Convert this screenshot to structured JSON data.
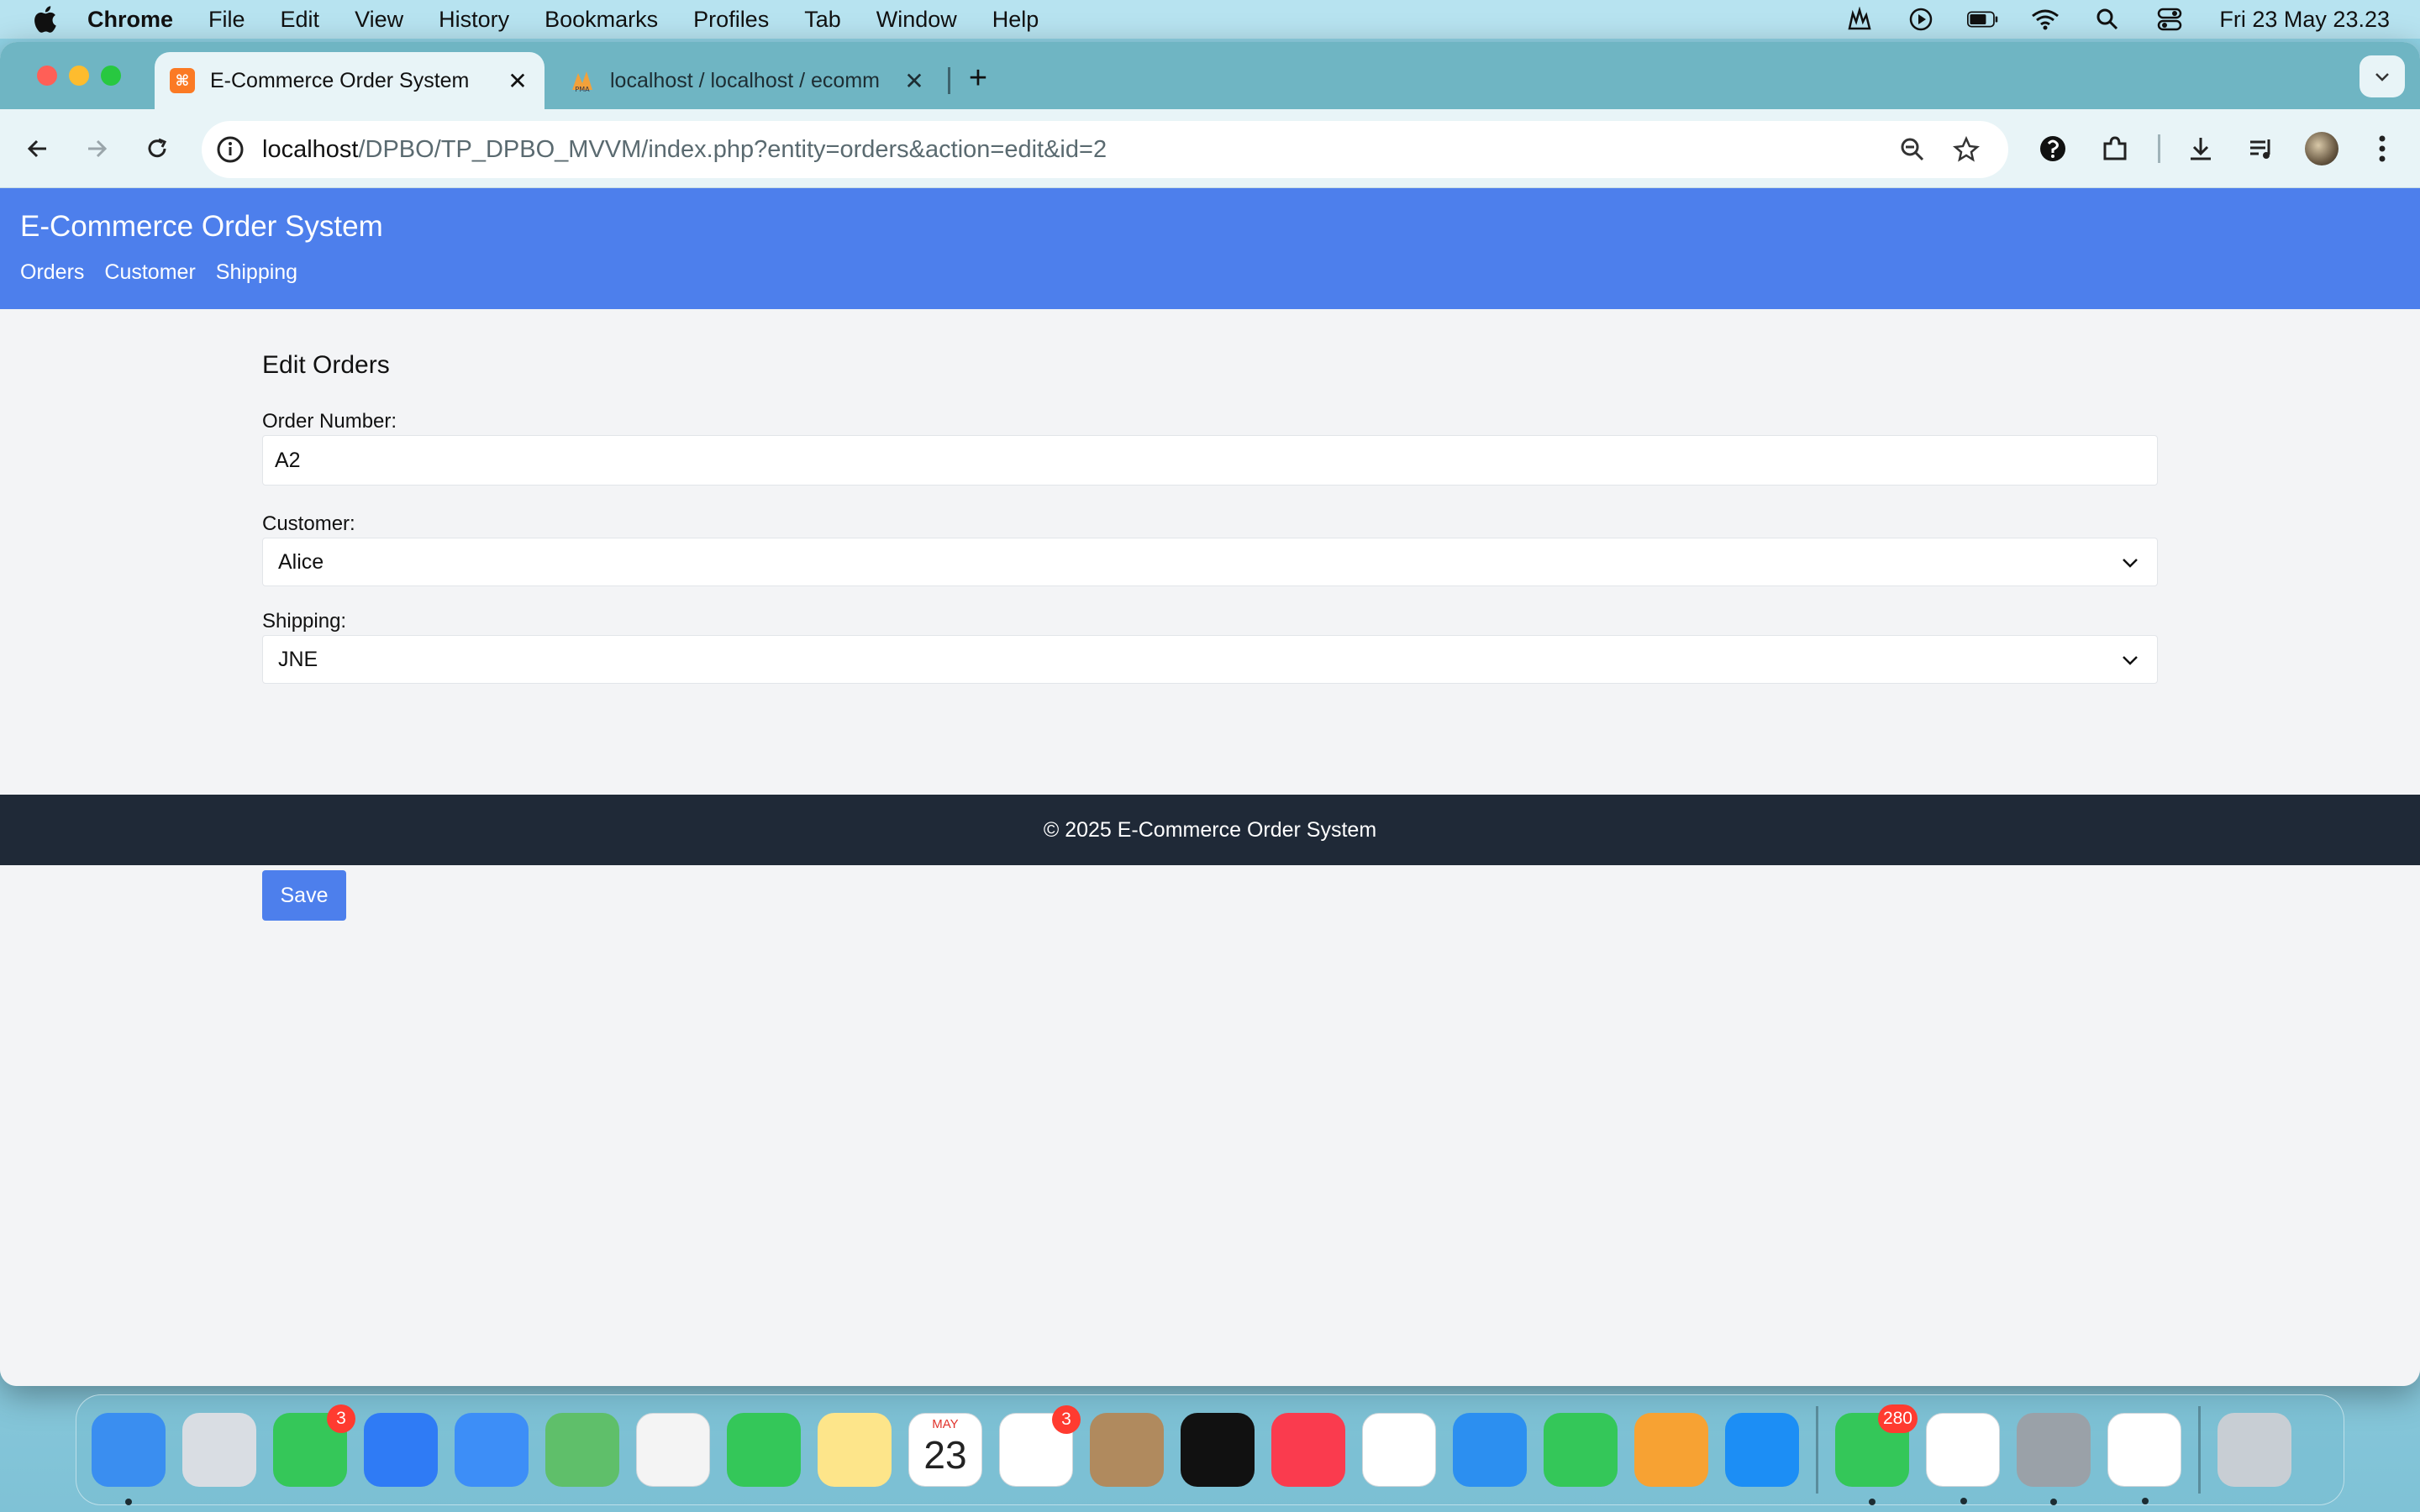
{
  "menubar": {
    "app_name": "Chrome",
    "items": [
      "File",
      "Edit",
      "View",
      "History",
      "Bookmarks",
      "Profiles",
      "Tab",
      "Window",
      "Help"
    ],
    "clock": "Fri 23 May  23.23"
  },
  "browser": {
    "tabs": [
      {
        "title": "E-Commerce Order System",
        "close": "✕"
      },
      {
        "title": "localhost / localhost / ecomm",
        "close": "✕"
      }
    ],
    "new_tab": "+",
    "address": {
      "host": "localhost",
      "path": "/DPBO/TP_DPBO_MVVM/index.php?entity=orders&action=edit&id=2"
    }
  },
  "site": {
    "title": "E-Commerce Order System",
    "nav": [
      "Orders",
      "Customer",
      "Shipping"
    ]
  },
  "form": {
    "title": "Edit Orders",
    "order_number_label": "Order Number:",
    "order_number_value": "A2",
    "customer_label": "Customer:",
    "customer_value": "Alice",
    "shipping_label": "Shipping:",
    "shipping_value": "JNE",
    "save_label": "Save"
  },
  "footer": {
    "text": "© 2025 E-Commerce Order System"
  },
  "dock": {
    "apps": [
      {
        "name": "finder-icon",
        "color": "#3a8ef0",
        "running": true
      },
      {
        "name": "launchpad-icon",
        "color": "#d9dde3"
      },
      {
        "name": "messages-icon",
        "color": "#35c759",
        "badge": "3"
      },
      {
        "name": "safari-icon",
        "color": "#2f7bf5"
      },
      {
        "name": "mail-icon",
        "color": "#3d8ef7"
      },
      {
        "name": "maps-icon",
        "color": "#5fbf6a"
      },
      {
        "name": "photos-icon",
        "color": "#f4f4f4"
      },
      {
        "name": "facetime-icon",
        "color": "#34c759"
      },
      {
        "name": "notes-icon",
        "color": "#fde58a"
      },
      {
        "name": "calendar-icon",
        "color": "#ffffff",
        "month": "MAY",
        "day": "23"
      },
      {
        "name": "reminders-icon",
        "color": "#ffffff",
        "badge": "3"
      },
      {
        "name": "contacts-icon",
        "color": "#b08a5e"
      },
      {
        "name": "apple-tv-icon",
        "color": "#111111"
      },
      {
        "name": "music-icon",
        "color": "#fa3b4e"
      },
      {
        "name": "freeform-icon",
        "color": "#ffffff"
      },
      {
        "name": "keynote-icon",
        "color": "#2c8ff0"
      },
      {
        "name": "numbers-icon",
        "color": "#34c759"
      },
      {
        "name": "pages-icon",
        "color": "#f7a233"
      },
      {
        "name": "app-store-icon",
        "color": "#1c8ef5"
      },
      {
        "name": "whatsapp-icon",
        "color": "#34c759",
        "badge": "280",
        "running": true
      },
      {
        "name": "chrome-icon",
        "color": "#ffffff",
        "running": true
      },
      {
        "name": "system-settings-icon",
        "color": "#9aa1a8",
        "running": true
      },
      {
        "name": "vscode-icon",
        "color": "#ffffff",
        "running": true
      },
      {
        "name": "trash-icon",
        "color": "#c8ced4"
      }
    ]
  },
  "colors": {
    "header_blue": "#4d7fec",
    "footer_dark": "#1f2937",
    "page_bg": "#f3f4f6"
  }
}
